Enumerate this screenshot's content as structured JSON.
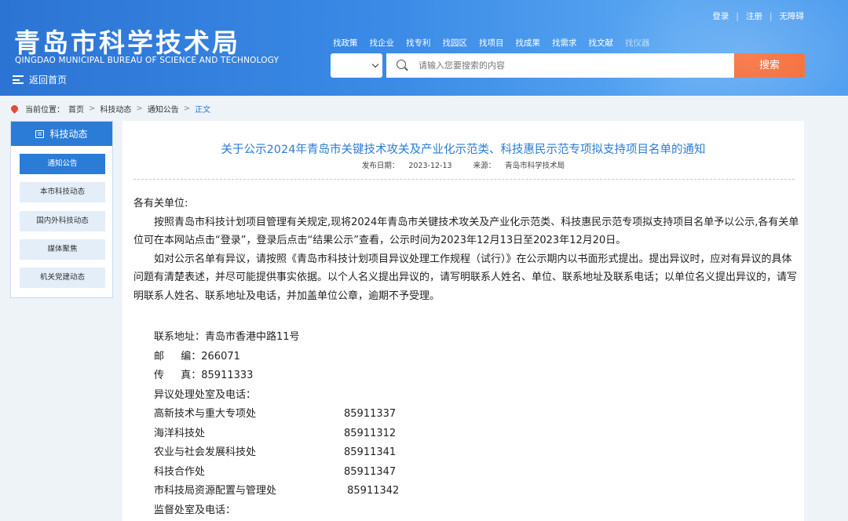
{
  "header": {
    "logo_cn": "青岛市科学技术局",
    "logo_en": "QINGDAO MUNICIPAL BUREAU OF SCIENCE AND TECHNOLOGY",
    "home_link": "返回首页",
    "top_links": [
      "登录",
      "注册",
      "无障碍"
    ],
    "nav_tabs": [
      "找政策",
      "找企业",
      "找专利",
      "找园区",
      "找项目",
      "找成果",
      "找需求",
      "找文献",
      "找仪器"
    ],
    "search": {
      "placeholder": "请输入您要搜索的内容",
      "button": "搜索"
    }
  },
  "breadcrumb": {
    "label": "当前位置：",
    "items": [
      "首页",
      "科技动态",
      "通知公告",
      "正文"
    ]
  },
  "sidebar": {
    "title": "科技动态",
    "items": [
      "通知公告",
      "本市科技动态",
      "国内外科技动态",
      "媒体聚焦",
      "机关党建动态"
    ],
    "active_index": 0
  },
  "article": {
    "title": "关于公示2024年青岛市关键技术攻关及产业化示范类、科技惠民示范专项拟支持项目名单的通知",
    "date_label": "发布日期：",
    "date": "2023-12-13",
    "source_label": "来源：",
    "source": "青岛市科学技术局",
    "salutation": "各有关单位:",
    "para1": "按照青岛市科技计划项目管理有关规定,现将2024年青岛市关键技术攻关及产业化示范类、科技惠民示范专项拟支持项目名单予以公示,各有关单位可在本网站点击“登录”，登录后点击“结果公示”查看，公示时间为2023年12月13日至2023年12月20日。",
    "para2": "如对公示名单有异议，请按照《青岛市科技计划项目异议处理工作规程（试行）》在公示期内以书面形式提出。提出异议时，应对有异议的具体问题有清楚表述，并尽可能提供事实依据。以个人名义提出异议的，请写明联系人姓名、单位、联系地址及联系电话；以单位名义提出异议的，请写明联系人姓名、联系地址及电话，并加盖单位公章，逾期不予受理。",
    "contact": {
      "address_label": "联系地址：",
      "address": "青岛市香港中路11号",
      "zip_label": "邮　  编：",
      "zip": "266071",
      "fax_label": "传　  真：",
      "fax": "85911333",
      "objection_heading": "异议处理处室及电话：",
      "departments": [
        {
          "name": "高新技术与重大专项处",
          "phone": "85911337"
        },
        {
          "name": "海洋科技处",
          "phone": "85911312"
        },
        {
          "name": "农业与社会发展科技处",
          "phone": "85911341"
        },
        {
          "name": "科技合作处",
          "phone": "85911347"
        },
        {
          "name": "市科技局资源配置与管理处",
          "phone": " 85911342"
        }
      ],
      "supervision_heading": "监督处室及电话："
    }
  },
  "colors": {
    "header_blue": "#2c74d4",
    "accent_blue": "#2b7cd6",
    "search_orange": "#f5632d"
  }
}
